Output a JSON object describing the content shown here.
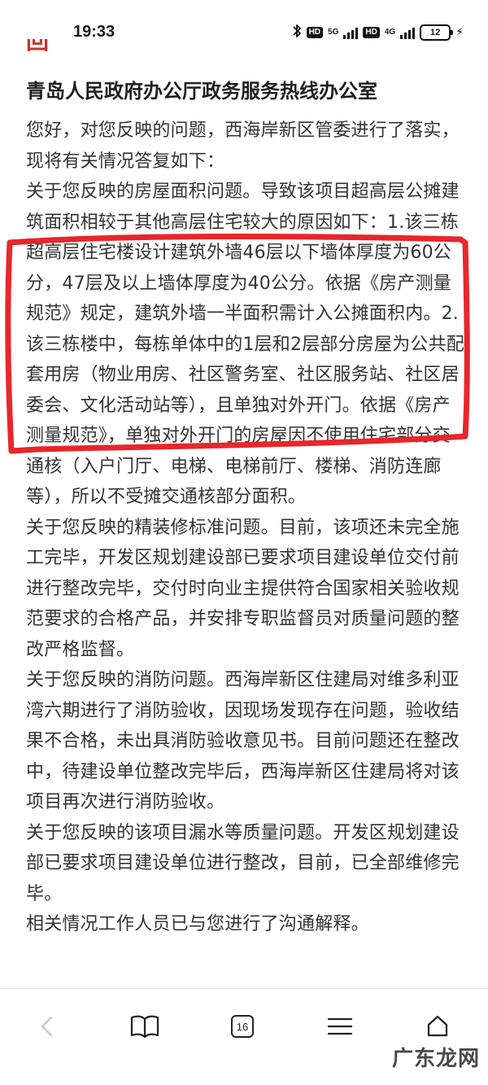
{
  "status_bar": {
    "time": "19:33",
    "bluetooth_icon": "bluetooth-icon",
    "hd_label_1": "HD",
    "net_1": "5G",
    "hd_label_2": "HD",
    "net_2": "4G",
    "battery_level": "12",
    "charging_icon": "lightning-icon"
  },
  "header_cut_text": "回复",
  "article": {
    "title": "青岛人民政府办公厅政务服务热线办公室",
    "paragraphs": [
      "您好，对您反映的问题，西海岸新区管委进行了落实，现将有关情况答复如下：",
      "关于您反映的房屋面积问题。导致该项目超高层公摊建筑面积相较于其他高层住宅较大的原因如下：1.该三栋超高层住宅楼设计建筑外墙46层以下墙体厚度为60公分，47层及以上墙体厚度为40公分。依据《房产测量规范》规定，建筑外墙一半面积需计入公摊面积内。2.该三栋楼中，每栋单体中的1层和2层部分房屋为公共配套用房（物业用房、社区警务室、社区服务站、社区居委会、文化活动站等），且单独对外开门。依据《房产测量规范》，单独对外开门的房屋因不使用住宅部分交通核（入户门厅、电梯、电梯前厅、楼梯、消防连廊等），所以不受摊交通核部分面积。",
      "关于您反映的精装修标准问题。目前，该项还未完全施工完毕，开发区规划建设部已要求项目建设单位交付前进行整改完毕，交付时向业主提供符合国家相关验收规范要求的合格产品，并安排专职监督员对质量问题的整改严格监督。",
      "关于您反映的消防问题。西海岸新区住建局对维多利亚湾六期进行了消防验收，因现场发现存在问题，验收结果不合格，未出具消防验收意见书。目前问题还在整改中，待建设单位整改完毕后，西海岸新区住建局将对该项目再次进行消防验收。",
      "关于您反映的该项目漏水等质量问题。开发区规划建设部已要求项目建设单位进行整改，目前，已全部维修完毕。",
      "相关情况工作人员已与您进行了沟通解释。"
    ]
  },
  "toolbar": {
    "back_icon": "chevron-left-icon",
    "bookmarks_icon": "book-icon",
    "tab_count": "16",
    "menu_icon": "hamburger-menu-icon",
    "home_icon": "home-icon"
  },
  "watermark": "广东龙网",
  "colors": {
    "highlight": "#e8262b",
    "heading_red": "#c8322a",
    "text": "#333333"
  }
}
